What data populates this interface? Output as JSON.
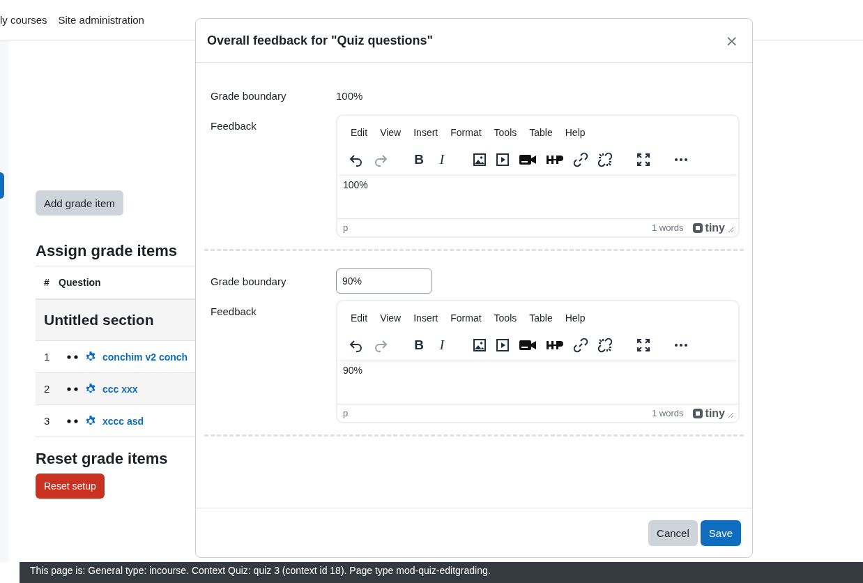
{
  "nav": [
    "ly courses",
    "Site administration"
  ],
  "page": {
    "add_button": "Add grade item",
    "assign_heading": "Assign grade items",
    "columns": [
      "#",
      "Question"
    ],
    "section": "Untitled section",
    "rows": [
      {
        "number": "1",
        "question": "conchim v2 conch"
      },
      {
        "number": "2",
        "question": "ccc xxx"
      },
      {
        "number": "3",
        "question": "xccc asd"
      }
    ],
    "reset_heading": "Reset grade items",
    "reset_button": "Reset setup"
  },
  "modal": {
    "title": "Overall feedback for \"Quiz questions\"",
    "close": "×",
    "entries": [
      {
        "kind": "static",
        "boundary_label": "Grade boundary",
        "boundary": "100%",
        "feedback_label": "Feedback",
        "editor": {
          "menu": [
            "Edit",
            "View",
            "Insert",
            "Format",
            "Tools",
            "Table",
            "Help"
          ],
          "bold": "B",
          "italic": "I",
          "redo_disabled": true,
          "content": "100%",
          "path": "p",
          "word_count": "1 words",
          "brand": "tiny"
        }
      },
      {
        "kind": "input",
        "boundary_label": "Grade boundary",
        "boundary": "90%",
        "feedback_label": "Feedback",
        "editor": {
          "menu": [
            "Edit",
            "View",
            "Insert",
            "Format",
            "Tools",
            "Table",
            "Help"
          ],
          "bold": "B",
          "italic": "I",
          "redo_disabled": true,
          "content": "90%",
          "path": "p",
          "word_count": "1 words",
          "brand": "tiny"
        }
      }
    ],
    "buttons": [
      "Cancel",
      "Save"
    ]
  },
  "footer": "This page is: General type: incourse. Context Quiz: quiz 3 (context id 18). Page type mod-quiz-editgrading."
}
